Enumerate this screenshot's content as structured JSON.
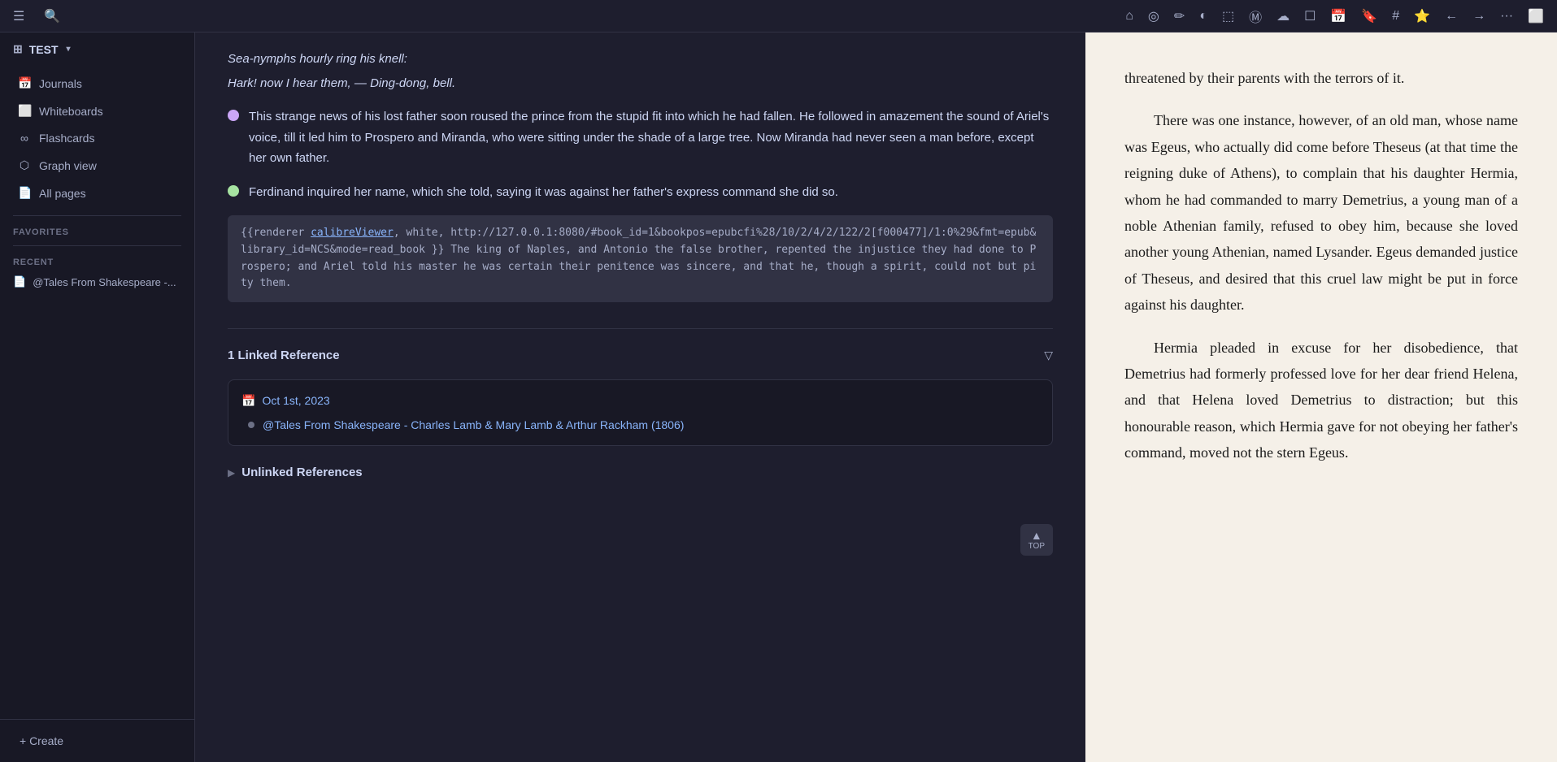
{
  "topbar": {
    "icons": [
      "⌂",
      "◎",
      "✎",
      "◐",
      "⬚",
      "Ⓜ",
      "☁",
      "☐",
      "📅",
      "🔖",
      "#",
      "⭐",
      "←",
      "→",
      "···",
      "⬜"
    ]
  },
  "sidebar": {
    "workspace": {
      "label": "TEST",
      "chevron": "▾"
    },
    "nav_items": [
      {
        "id": "journals",
        "icon": "📅",
        "label": "Journals"
      },
      {
        "id": "whiteboards",
        "icon": "⬜",
        "label": "Whiteboards"
      },
      {
        "id": "flashcards",
        "icon": "∞",
        "label": "Flashcards"
      },
      {
        "id": "graph-view",
        "icon": "⬡",
        "label": "Graph view"
      },
      {
        "id": "all-pages",
        "icon": "📄",
        "label": "All pages"
      }
    ],
    "favorites_label": "FAVORITES",
    "recent_label": "RECENT",
    "recent_items": [
      {
        "id": "tales",
        "icon": "📄",
        "label": "@Tales From Shakespeare -..."
      }
    ],
    "create_label": "+ Create"
  },
  "note": {
    "poem_lines": [
      "Sea-nymphs hourly ring his knell:",
      "Hark! now I hear them, — Ding-dong, bell."
    ],
    "block1": {
      "bullet_color": "purple",
      "text": "This strange news of his lost father soon roused the prince from the stupid fit into which he had fallen. He followed in amazement the sound of Ariel's voice, till it led him to Prospero and Miranda, who were sitting under the shade of a large tree. Now Miranda had never seen a man before, except her own father."
    },
    "block2": {
      "bullet_color": "green",
      "text": "Ferdinand inquired her name, which she told, saying it was against her father's express command she did so."
    },
    "code_block": "{{renderer calibreViewer, white, http://127.0.0.1:8080/#book_id=1&bookpos=epubcfi%28/10/2/4/2/122/2[f000477]/1:0%29&fmt=epub&library_id=NCS&mode=read_book }} The king of Naples, and Antonio the false brother, repented the injustice they had done to Prospero; and Ariel told his master he was certain their penitence was sincere, and that he, though a spirit, could not but pity them.",
    "linked_refs": {
      "title": "1 Linked Reference",
      "filter_icon": "▽",
      "refs": [
        {
          "date": "Oct 1st, 2023",
          "link_text": "@Tales From Shakespeare - Charles Lamb & Mary Lamb & Arthur Rackham (1806)"
        }
      ]
    },
    "unlinked_refs": {
      "title": "Unlinked References",
      "chevron": "▶"
    },
    "top_button": "TOP"
  },
  "reader": {
    "paragraphs": [
      "threatened by their parents with the terrors of it.",
      "There was one instance, however, of an old man, whose name was Egeus, who actually did come before Theseus (at that time the reigning duke of Athens), to complain that his daughter Hermia, whom he had commanded to marry Demetrius, a young man of a noble Athenian family, refused to obey him, because she loved another young Athenian, named Lysander. Egeus demanded justice of Theseus, and desired that this cruel law might be put in force against his daughter.",
      "Hermia pleaded in excuse for her disobedience, that Demetrius had formerly professed love for her dear friend Helena, and that Helena loved Demetrius to distraction; but this honourable reason, which Hermia gave for not obeying her father's command, moved not the stern Egeus."
    ]
  }
}
